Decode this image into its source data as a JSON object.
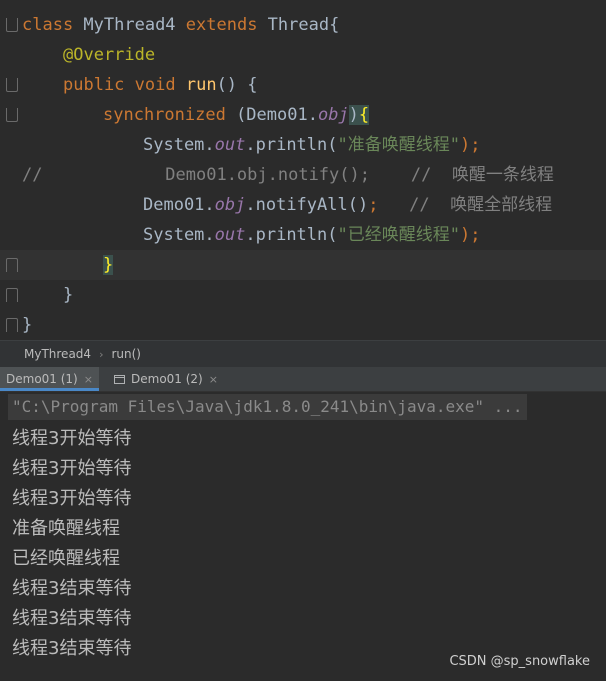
{
  "editor": {
    "line1": {
      "kw_class": "class",
      "name": " MyThread4 ",
      "kw_extends": "extends",
      "rest": " Thread{"
    },
    "line2": {
      "annotation": "@Override"
    },
    "line3": {
      "kw_public": "public",
      "kw_void": " void",
      "fn": " run",
      "rest": "() {"
    },
    "line4": {
      "kw_sync": "synchronized",
      "p1": " (Demo01.",
      "field": "obj",
      "p2": ")",
      "brace": "{"
    },
    "line5": {
      "a": "System.",
      "field": "out",
      "b": ".println(",
      "str": "\"准备唤醒线程\"",
      "end": ");"
    },
    "line6": {
      "comment": "//            Demo01.obj.notify();    //  唤醒一条线程"
    },
    "line7": {
      "a": "Demo01.",
      "field": "obj",
      "b": ".notifyAll()",
      "semi": ";",
      "cmt": "   //  唤醒全部线程"
    },
    "line8": {
      "a": "System.",
      "field": "out",
      "b": ".println(",
      "str": "\"已经唤醒线程\"",
      "end": ");"
    },
    "line9": {
      "brace": "}"
    },
    "line10": {
      "brace": "}"
    },
    "line11": {
      "brace": "}"
    }
  },
  "breadcrumb": {
    "class_name": "MyThread4",
    "separator": "›",
    "method": "run()"
  },
  "tabs": [
    {
      "label": "Demo01 (1)",
      "close": "×"
    },
    {
      "label": "Demo01 (2)",
      "close": "×"
    }
  ],
  "console": {
    "command": "\"C:\\Program Files\\Java\\jdk1.8.0_241\\bin\\java.exe\" ...",
    "lines": [
      "线程3开始等待",
      "线程3开始等待",
      "线程3开始等待",
      "准备唤醒线程",
      "已经唤醒线程",
      "线程3结束等待",
      "线程3结束等待",
      "线程3结束等待"
    ]
  },
  "watermark": "CSDN @sp_snowflake"
}
